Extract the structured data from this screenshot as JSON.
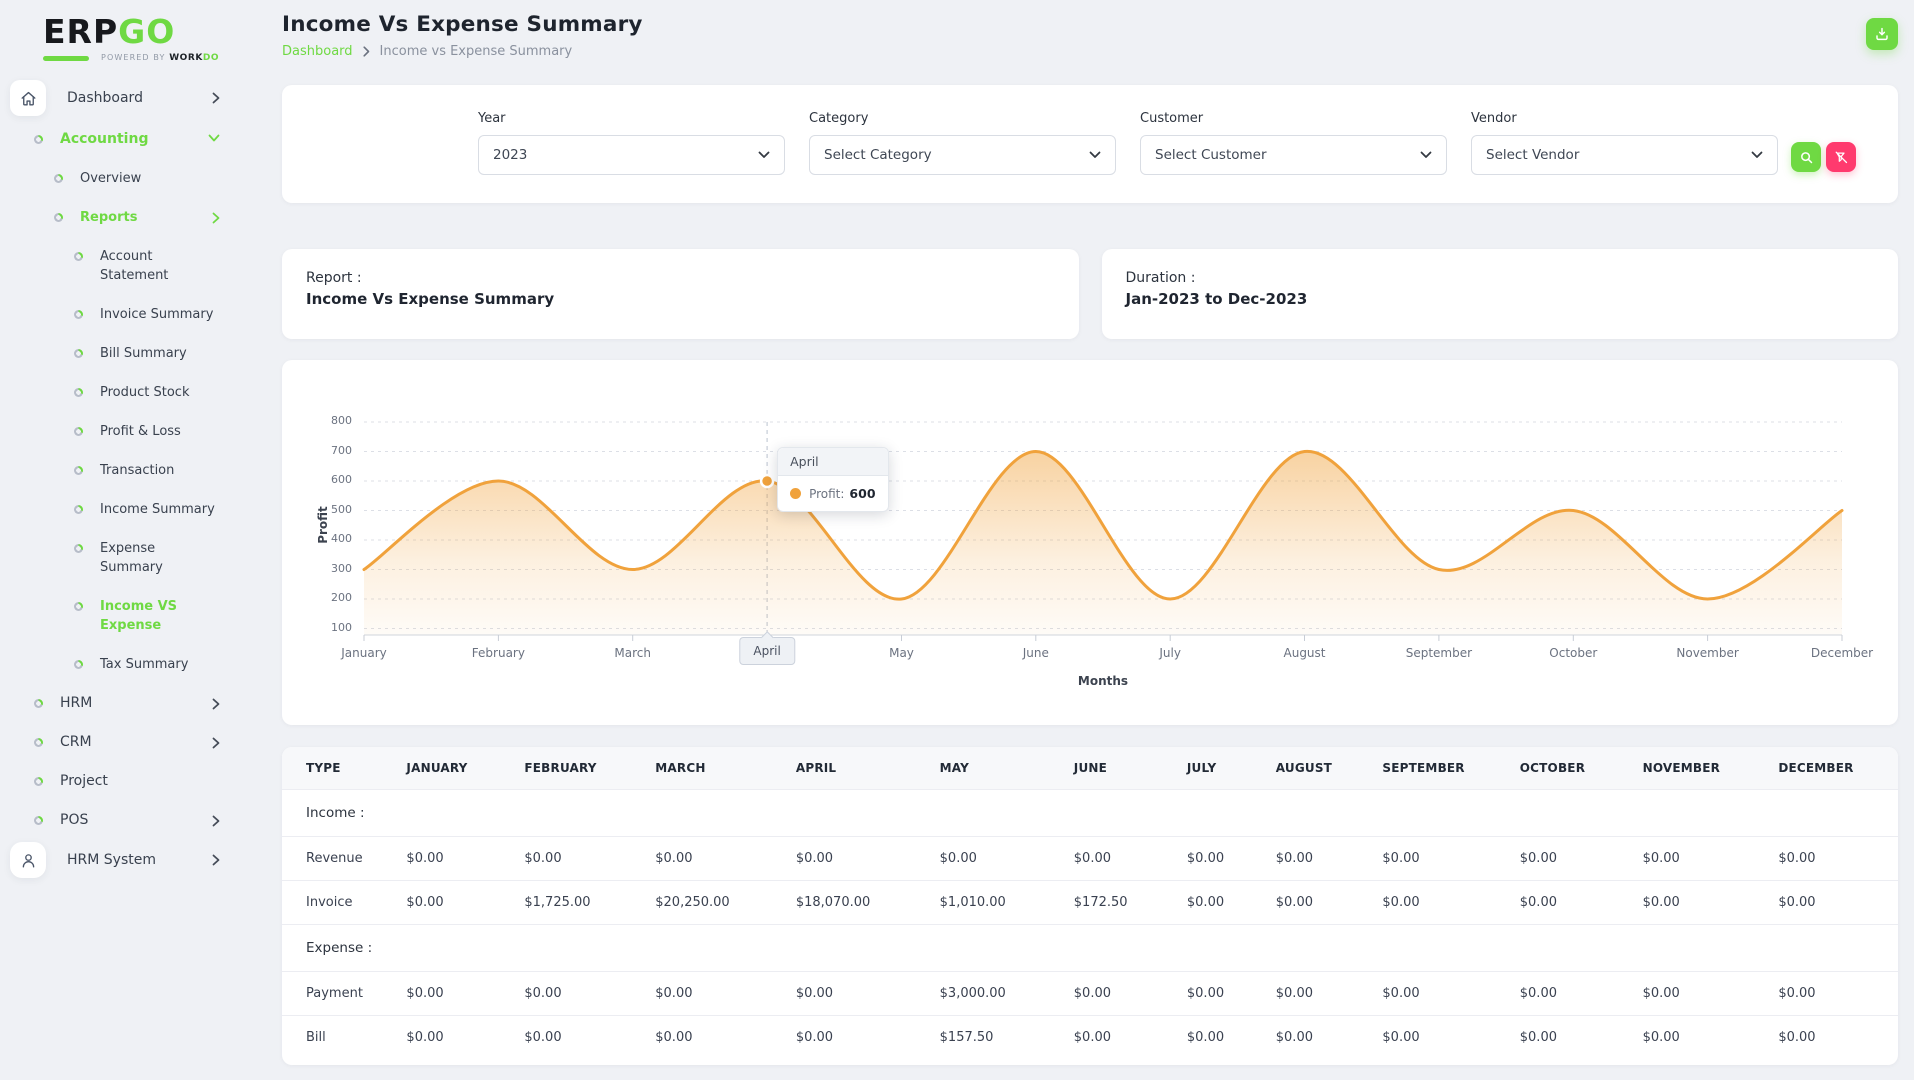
{
  "brand": {
    "name_dark": "ERP",
    "name_green": "GO",
    "tagline": "Powered By",
    "company_dark": "WORK",
    "company_green": "DO"
  },
  "colors": {
    "accent_green": "#6fd943",
    "danger_pink": "#ff3a6e",
    "chart_line_orange": "#f0a23c"
  },
  "sidebar": {
    "items": [
      {
        "label": "Dashboard",
        "level": 0,
        "icon": "home",
        "boxed": true,
        "chevron": "right",
        "active": false
      },
      {
        "label": "Accounting",
        "level": 0,
        "bullet": true,
        "chevron": "down",
        "active": true
      },
      {
        "label": "Overview",
        "level": 1,
        "bullet": true,
        "active": false
      },
      {
        "label": "Reports",
        "level": 1,
        "bullet": true,
        "chevron": "right",
        "active": true
      },
      {
        "label": "Account Statement",
        "level": 2,
        "bullet": true,
        "active": false
      },
      {
        "label": "Invoice Summary",
        "level": 2,
        "bullet": true,
        "active": false
      },
      {
        "label": "Bill Summary",
        "level": 2,
        "bullet": true,
        "active": false
      },
      {
        "label": "Product Stock",
        "level": 2,
        "bullet": true,
        "active": false
      },
      {
        "label": "Profit & Loss",
        "level": 2,
        "bullet": true,
        "active": false
      },
      {
        "label": "Transaction",
        "level": 2,
        "bullet": true,
        "active": false
      },
      {
        "label": "Income Summary",
        "level": 2,
        "bullet": true,
        "active": false
      },
      {
        "label": "Expense Summary",
        "level": 2,
        "bullet": true,
        "active": false
      },
      {
        "label": "Income VS Expense",
        "level": 2,
        "bullet": true,
        "active": true
      },
      {
        "label": "Tax Summary",
        "level": 2,
        "bullet": true,
        "active": false
      },
      {
        "label": "HRM",
        "level": 0,
        "bullet": true,
        "chevron": "right",
        "active": false
      },
      {
        "label": "CRM",
        "level": 0,
        "bullet": true,
        "chevron": "right",
        "active": false
      },
      {
        "label": "Project",
        "level": 0,
        "bullet": true,
        "active": false
      },
      {
        "label": "POS",
        "level": 0,
        "bullet": true,
        "chevron": "right",
        "active": false
      },
      {
        "label": "HRM System",
        "level": 0,
        "icon": "user",
        "boxed": true,
        "chevron": "right",
        "active": false
      }
    ]
  },
  "header": {
    "title": "Income Vs Expense Summary",
    "breadcrumb": [
      "Dashboard",
      "Income vs Expense Summary"
    ]
  },
  "filters": {
    "fields": [
      {
        "name": "year",
        "label": "Year",
        "value": "2023"
      },
      {
        "name": "category",
        "label": "Category",
        "value": "Select Category"
      },
      {
        "name": "customer",
        "label": "Customer",
        "value": "Select Customer"
      },
      {
        "name": "vendor",
        "label": "Vendor",
        "value": "Select Vendor"
      }
    ]
  },
  "cards": {
    "report_label": "Report :",
    "report_value": "Income Vs Expense Summary",
    "duration_label": "Duration :",
    "duration_value": "Jan-2023 to Dec-2023"
  },
  "chart_data": {
    "type": "area",
    "x": [
      "January",
      "February",
      "March",
      "April",
      "May",
      "June",
      "July",
      "August",
      "September",
      "October",
      "November",
      "December"
    ],
    "series": [
      {
        "name": "Profit",
        "values": [
          300,
          600,
          300,
          600,
          200,
          700,
          200,
          700,
          300,
          500,
          200,
          500
        ]
      }
    ],
    "xlabel": "Months",
    "ylabel": "Profit",
    "ylim": [
      100,
      800
    ],
    "y_ticks": [
      100,
      200,
      300,
      400,
      500,
      600,
      700,
      800
    ],
    "grid": "dashed-horizontal",
    "legend": "none",
    "line_color": "#f0a23c",
    "highlight": {
      "month": "April",
      "index": 3,
      "series": "Profit",
      "value": 600,
      "value_label": "600"
    }
  },
  "table": {
    "headers": [
      "TYPE",
      "JANUARY",
      "FEBRUARY",
      "MARCH",
      "APRIL",
      "MAY",
      "JUNE",
      "JULY",
      "AUGUST",
      "SEPTEMBER",
      "OCTOBER",
      "NOVEMBER",
      "DECEMBER"
    ],
    "sections": [
      {
        "title": "Income :",
        "rows": [
          {
            "type": "Revenue",
            "values": [
              "$0.00",
              "$0.00",
              "$0.00",
              "$0.00",
              "$0.00",
              "$0.00",
              "$0.00",
              "$0.00",
              "$0.00",
              "$0.00",
              "$0.00",
              "$0.00"
            ]
          },
          {
            "type": "Invoice",
            "values": [
              "$0.00",
              "$1,725.00",
              "$20,250.00",
              "$18,070.00",
              "$1,010.00",
              "$172.50",
              "$0.00",
              "$0.00",
              "$0.00",
              "$0.00",
              "$0.00",
              "$0.00"
            ]
          }
        ]
      },
      {
        "title": "Expense :",
        "rows": [
          {
            "type": "Payment",
            "values": [
              "$0.00",
              "$0.00",
              "$0.00",
              "$0.00",
              "$3,000.00",
              "$0.00",
              "$0.00",
              "$0.00",
              "$0.00",
              "$0.00",
              "$0.00",
              "$0.00"
            ]
          },
          {
            "type": "Bill",
            "values": [
              "$0.00",
              "$0.00",
              "$0.00",
              "$0.00",
              "$157.50",
              "$0.00",
              "$0.00",
              "$0.00",
              "$0.00",
              "$0.00",
              "$0.00",
              "$0.00"
            ]
          }
        ]
      }
    ]
  }
}
